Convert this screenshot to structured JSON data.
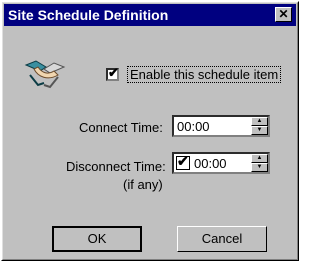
{
  "window": {
    "title": "Site Schedule Definition",
    "close_glyph": "✕"
  },
  "enable": {
    "label": "Enable this schedule item",
    "checked": true
  },
  "connect": {
    "label": "Connect Time:",
    "value": "00:00"
  },
  "disconnect": {
    "label": "Disconnect Time:",
    "sublabel": "(if any)",
    "value": "00:00",
    "checked": true
  },
  "buttons": {
    "ok": "OK",
    "cancel": "Cancel"
  },
  "icons": {
    "app": "handshake-icon"
  }
}
